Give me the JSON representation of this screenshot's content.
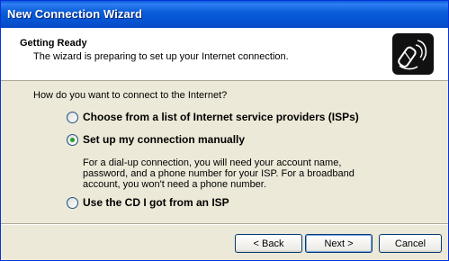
{
  "window": {
    "title": "New Connection Wizard"
  },
  "header": {
    "title": "Getting Ready",
    "subtitle": "The wizard is preparing to set up your Internet connection.",
    "icon": "phone-connection-icon"
  },
  "content": {
    "question": "How do you want to connect to the Internet?",
    "options": [
      {
        "label": "Choose from a list of Internet service providers (ISPs)",
        "selected": false
      },
      {
        "label": "Set up my connection manually",
        "selected": true
      },
      {
        "label": "Use the CD I got from an ISP",
        "selected": false
      }
    ],
    "manual_description": "For a dial-up connection, you will need your account name, password, and a phone number for your ISP. For a broadband account, you won't need a phone number."
  },
  "buttons": {
    "back": "< Back",
    "next": "Next >",
    "cancel": "Cancel"
  }
}
